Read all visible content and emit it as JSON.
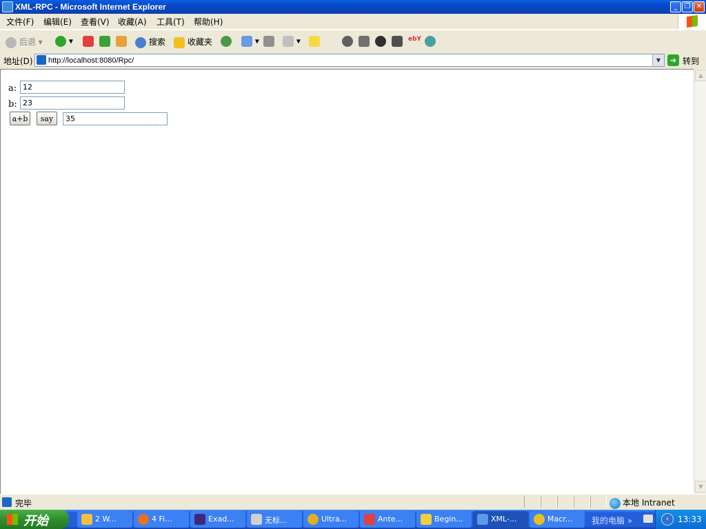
{
  "window": {
    "title": "XML-RPC - Microsoft Internet Explorer"
  },
  "menu": [
    "文件(F)",
    "编辑(E)",
    "查看(V)",
    "收藏(A)",
    "工具(T)",
    "帮助(H)"
  ],
  "toolbar": {
    "back": "后退",
    "search": "搜索",
    "favorites": "收藏夹"
  },
  "address": {
    "label": "地址(D)",
    "url": "http://localhost:8080/Rpc/",
    "go": "转到"
  },
  "form": {
    "a_label": "a:",
    "a_value": "12",
    "b_label": "b:",
    "b_value": "23",
    "add_button": "a+b",
    "say_button": "say",
    "result_value": "35"
  },
  "status": {
    "text": "完毕",
    "zone": "本地 Intranet"
  },
  "taskbar": {
    "start": "开始",
    "tasks": [
      "2 W...",
      "4 Fi...",
      "Exad...",
      "无标...",
      "Ultra...",
      "Ante...",
      "Begin...",
      "XML-...",
      "Macr..."
    ],
    "my_computer": "我的电脑",
    "clock": "13:33"
  }
}
